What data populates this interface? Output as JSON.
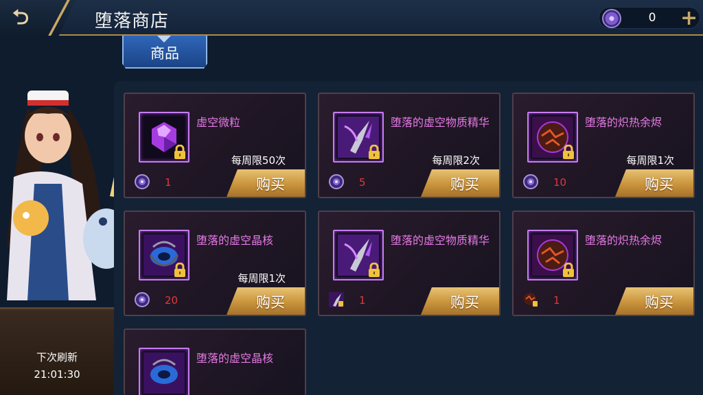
{
  "header": {
    "title": "堕落商店",
    "currency": {
      "icon": "void-particle-icon",
      "value": "0"
    }
  },
  "tabs": [
    {
      "label": "商品",
      "active": true
    }
  ],
  "refresh": {
    "label": "下次刷新",
    "time": "21:01:30"
  },
  "buy_label": "购买",
  "items": [
    {
      "name": "虚空微粒",
      "limit": "每周限50次",
      "cost": "1",
      "cost_icon": "void-particle-icon",
      "art": "purple-gem"
    },
    {
      "name": "堕落的虚空物质精华",
      "limit": "每周限2次",
      "cost": "5",
      "cost_icon": "void-particle-icon",
      "art": "void-claw"
    },
    {
      "name": "堕落的炽热余烬",
      "limit": "每周限1次",
      "cost": "10",
      "cost_icon": "void-particle-icon",
      "art": "ember-orb"
    },
    {
      "name": "堕落的虚空晶核",
      "limit": "每周限1次",
      "cost": "20",
      "cost_icon": "void-particle-icon",
      "art": "void-core"
    },
    {
      "name": "堕落的虚空物质精华",
      "limit": "",
      "cost": "1",
      "cost_icon": "void-claw-icon",
      "art": "void-claw"
    },
    {
      "name": "堕落的炽热余烬",
      "limit": "",
      "cost": "1",
      "cost_icon": "ember-orb-icon",
      "art": "ember-orb"
    },
    {
      "name": "堕落的虚空晶核",
      "limit": "",
      "cost": "",
      "cost_icon": "",
      "art": "void-core"
    }
  ],
  "colors": {
    "item_name": "#e67ae6",
    "cost_value": "#e23a3a",
    "buy_button": "#d2a24a",
    "tab_active": "#2a5fae"
  }
}
